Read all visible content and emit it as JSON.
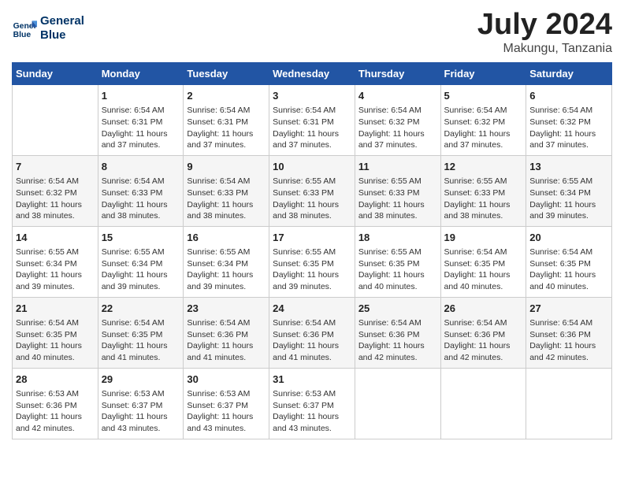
{
  "header": {
    "logo_line1": "General",
    "logo_line2": "Blue",
    "main_title": "July 2024",
    "subtitle": "Makungu, Tanzania"
  },
  "days_of_week": [
    "Sunday",
    "Monday",
    "Tuesday",
    "Wednesday",
    "Thursday",
    "Friday",
    "Saturday"
  ],
  "weeks": [
    [
      {
        "day": "",
        "info": ""
      },
      {
        "day": "1",
        "info": "Sunrise: 6:54 AM\nSunset: 6:31 PM\nDaylight: 11 hours\nand 37 minutes."
      },
      {
        "day": "2",
        "info": "Sunrise: 6:54 AM\nSunset: 6:31 PM\nDaylight: 11 hours\nand 37 minutes."
      },
      {
        "day": "3",
        "info": "Sunrise: 6:54 AM\nSunset: 6:31 PM\nDaylight: 11 hours\nand 37 minutes."
      },
      {
        "day": "4",
        "info": "Sunrise: 6:54 AM\nSunset: 6:32 PM\nDaylight: 11 hours\nand 37 minutes."
      },
      {
        "day": "5",
        "info": "Sunrise: 6:54 AM\nSunset: 6:32 PM\nDaylight: 11 hours\nand 37 minutes."
      },
      {
        "day": "6",
        "info": "Sunrise: 6:54 AM\nSunset: 6:32 PM\nDaylight: 11 hours\nand 37 minutes."
      }
    ],
    [
      {
        "day": "7",
        "info": "Sunrise: 6:54 AM\nSunset: 6:32 PM\nDaylight: 11 hours\nand 38 minutes."
      },
      {
        "day": "8",
        "info": "Sunrise: 6:54 AM\nSunset: 6:33 PM\nDaylight: 11 hours\nand 38 minutes."
      },
      {
        "day": "9",
        "info": "Sunrise: 6:54 AM\nSunset: 6:33 PM\nDaylight: 11 hours\nand 38 minutes."
      },
      {
        "day": "10",
        "info": "Sunrise: 6:55 AM\nSunset: 6:33 PM\nDaylight: 11 hours\nand 38 minutes."
      },
      {
        "day": "11",
        "info": "Sunrise: 6:55 AM\nSunset: 6:33 PM\nDaylight: 11 hours\nand 38 minutes."
      },
      {
        "day": "12",
        "info": "Sunrise: 6:55 AM\nSunset: 6:33 PM\nDaylight: 11 hours\nand 38 minutes."
      },
      {
        "day": "13",
        "info": "Sunrise: 6:55 AM\nSunset: 6:34 PM\nDaylight: 11 hours\nand 39 minutes."
      }
    ],
    [
      {
        "day": "14",
        "info": "Sunrise: 6:55 AM\nSunset: 6:34 PM\nDaylight: 11 hours\nand 39 minutes."
      },
      {
        "day": "15",
        "info": "Sunrise: 6:55 AM\nSunset: 6:34 PM\nDaylight: 11 hours\nand 39 minutes."
      },
      {
        "day": "16",
        "info": "Sunrise: 6:55 AM\nSunset: 6:34 PM\nDaylight: 11 hours\nand 39 minutes."
      },
      {
        "day": "17",
        "info": "Sunrise: 6:55 AM\nSunset: 6:35 PM\nDaylight: 11 hours\nand 39 minutes."
      },
      {
        "day": "18",
        "info": "Sunrise: 6:55 AM\nSunset: 6:35 PM\nDaylight: 11 hours\nand 40 minutes."
      },
      {
        "day": "19",
        "info": "Sunrise: 6:54 AM\nSunset: 6:35 PM\nDaylight: 11 hours\nand 40 minutes."
      },
      {
        "day": "20",
        "info": "Sunrise: 6:54 AM\nSunset: 6:35 PM\nDaylight: 11 hours\nand 40 minutes."
      }
    ],
    [
      {
        "day": "21",
        "info": "Sunrise: 6:54 AM\nSunset: 6:35 PM\nDaylight: 11 hours\nand 40 minutes."
      },
      {
        "day": "22",
        "info": "Sunrise: 6:54 AM\nSunset: 6:35 PM\nDaylight: 11 hours\nand 41 minutes."
      },
      {
        "day": "23",
        "info": "Sunrise: 6:54 AM\nSunset: 6:36 PM\nDaylight: 11 hours\nand 41 minutes."
      },
      {
        "day": "24",
        "info": "Sunrise: 6:54 AM\nSunset: 6:36 PM\nDaylight: 11 hours\nand 41 minutes."
      },
      {
        "day": "25",
        "info": "Sunrise: 6:54 AM\nSunset: 6:36 PM\nDaylight: 11 hours\nand 42 minutes."
      },
      {
        "day": "26",
        "info": "Sunrise: 6:54 AM\nSunset: 6:36 PM\nDaylight: 11 hours\nand 42 minutes."
      },
      {
        "day": "27",
        "info": "Sunrise: 6:54 AM\nSunset: 6:36 PM\nDaylight: 11 hours\nand 42 minutes."
      }
    ],
    [
      {
        "day": "28",
        "info": "Sunrise: 6:53 AM\nSunset: 6:36 PM\nDaylight: 11 hours\nand 42 minutes."
      },
      {
        "day": "29",
        "info": "Sunrise: 6:53 AM\nSunset: 6:37 PM\nDaylight: 11 hours\nand 43 minutes."
      },
      {
        "day": "30",
        "info": "Sunrise: 6:53 AM\nSunset: 6:37 PM\nDaylight: 11 hours\nand 43 minutes."
      },
      {
        "day": "31",
        "info": "Sunrise: 6:53 AM\nSunset: 6:37 PM\nDaylight: 11 hours\nand 43 minutes."
      },
      {
        "day": "",
        "info": ""
      },
      {
        "day": "",
        "info": ""
      },
      {
        "day": "",
        "info": ""
      }
    ]
  ]
}
